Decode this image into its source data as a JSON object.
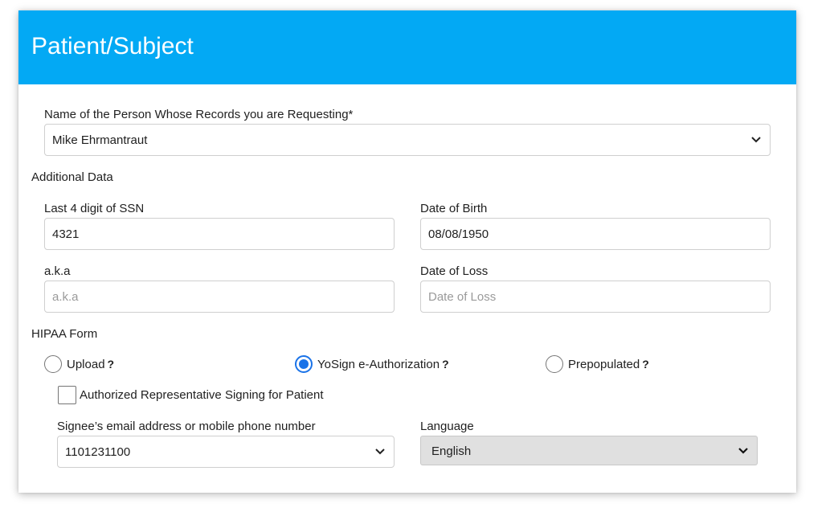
{
  "header": {
    "title": "Patient/Subject"
  },
  "patient_name": {
    "label": "Name of the Person Whose Records you are Requesting*",
    "value": "Mike Ehrmantraut",
    "icon": "chevron-down-icon"
  },
  "additional_data": {
    "section_label": "Additional Data",
    "ssn": {
      "label": "Last 4 digit of SSN",
      "value": "4321"
    },
    "dob": {
      "label": "Date of Birth",
      "value": "08/08/1950"
    },
    "aka": {
      "label": "a.k.a",
      "value": "",
      "placeholder": "a.k.a"
    },
    "date_of_loss": {
      "label": "Date of Loss",
      "value": "",
      "placeholder": "Date of Loss"
    }
  },
  "hipaa": {
    "section_label": "HIPAA Form",
    "options": [
      {
        "label": "Upload",
        "help": "?",
        "selected": false
      },
      {
        "label": "YoSign e-Authorization",
        "help": "?",
        "selected": true
      },
      {
        "label": "Prepopulated",
        "help": "?",
        "selected": false
      }
    ],
    "authorized_rep": {
      "label": "Authorized Representative Signing for Patient",
      "checked": false
    },
    "signee": {
      "label": "Signee’s email address or mobile phone number",
      "value": "1101231100",
      "icon": "chevron-down-icon"
    },
    "language": {
      "label": "Language",
      "value": "English",
      "icon": "chevron-down-icon"
    }
  },
  "colors": {
    "header_bg": "#03a9f4",
    "radio_selected": "#1a73e8",
    "language_select_bg": "#e0e0e0"
  }
}
